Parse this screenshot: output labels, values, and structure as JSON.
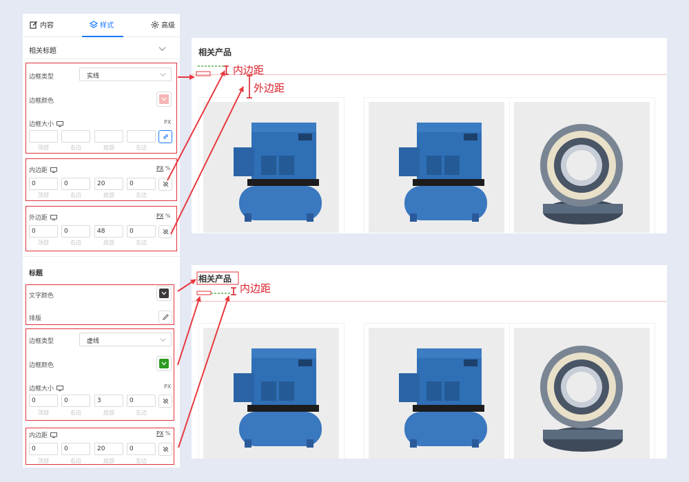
{
  "tabs": [
    {
      "label": "内容",
      "icon": "edit-icon",
      "active": false
    },
    {
      "label": "样式",
      "icon": "layers-icon",
      "active": true
    },
    {
      "label": "高级",
      "icon": "gear-icon",
      "active": false
    }
  ],
  "section_related_title": "相关标题",
  "section_title": "标题",
  "border_type_label": "边框类型",
  "border_color_label": "边框颜色",
  "border_size_label": "边框大小",
  "padding_label": "内边距",
  "margin_label": "外边距",
  "text_color_label": "文字颜色",
  "typography_label": "排版",
  "unit_px": "PX",
  "unit_percent": "%",
  "captions": {
    "top": "顶部",
    "right": "右边",
    "bottom": "底部",
    "left": "左边"
  },
  "group1": {
    "border_type": "实线",
    "border_color": "#f7b6b6",
    "border_size": {
      "top": "",
      "right": "",
      "bottom": "",
      "left": ""
    },
    "padding": {
      "top": "0",
      "right": "0",
      "bottom": "20",
      "left": "0"
    },
    "margin": {
      "top": "0",
      "right": "0",
      "bottom": "48",
      "left": "0"
    }
  },
  "group2": {
    "text_color": "#3a3a3a",
    "border_type": "虚线",
    "border_color": "#2f9b22",
    "border_size": {
      "top": "0",
      "right": "0",
      "bottom": "3",
      "left": "0"
    },
    "padding": {
      "top": "0",
      "right": "0",
      "bottom": "20",
      "left": "0"
    }
  },
  "preview": {
    "title": "相关产品",
    "products": [
      {
        "image": "air-compressor-image"
      },
      {
        "image": "air-compressor-image"
      },
      {
        "image": "bearing-image"
      }
    ]
  },
  "annotations": {
    "padding": "内边距",
    "margin": "外边距"
  },
  "colors": {
    "accent": "#1677ff",
    "annotation_red": "#e0303a",
    "dashed_green": "#3a9a2a"
  }
}
